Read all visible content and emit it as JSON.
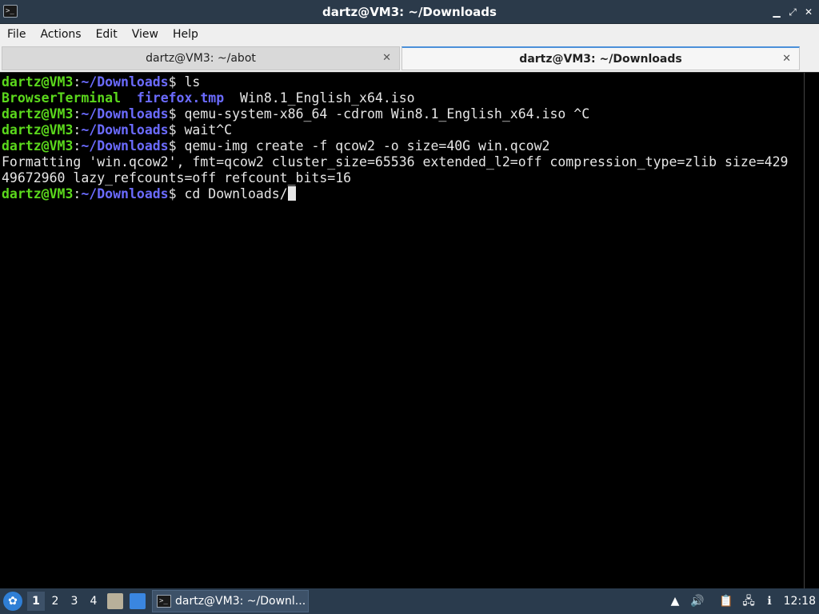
{
  "window": {
    "title": "dartz@VM3: ~/Downloads",
    "app_icon": ">_",
    "minimize_symbol": "▁",
    "maximize_symbol": "⤢",
    "close_symbol": "✕"
  },
  "menu": {
    "items": [
      "File",
      "Actions",
      "Edit",
      "View",
      "Help"
    ]
  },
  "tabs": [
    {
      "label": "dartz@VM3: ~/abot",
      "active": false,
      "close": "✕"
    },
    {
      "label": "dartz@VM3: ~/Downloads",
      "active": true,
      "close": "✕"
    }
  ],
  "terminal": {
    "prompt_user": "dartz@VM3",
    "prompt_sep": ":",
    "prompt_path": "~/Downloads",
    "prompt_end": "$",
    "lines": [
      {
        "type": "cmd",
        "text": " ls"
      },
      {
        "type": "ls",
        "items": [
          {
            "text": "BrowserTerminal",
            "style": "green"
          },
          {
            "text": "  ",
            "style": "plain"
          },
          {
            "text": "firefox.tmp",
            "style": "blue"
          },
          {
            "text": "  Win8.1_English_x64.iso",
            "style": "plain"
          }
        ]
      },
      {
        "type": "cmd",
        "text": " qemu-system-x86_64 -cdrom Win8.1_English_x64.iso ^C"
      },
      {
        "type": "cmd",
        "text": " wait^C"
      },
      {
        "type": "cmd",
        "text": " qemu-img create -f qcow2 -o size=40G win.qcow2"
      },
      {
        "type": "out",
        "text": "Formatting 'win.qcow2', fmt=qcow2 cluster_size=65536 extended_l2=off compression_type=zlib size=429"
      },
      {
        "type": "out",
        "text": "49672960 lazy_refcounts=off refcount_bits=16"
      },
      {
        "type": "cmd",
        "text": " cd Downloads/",
        "cursor": true
      }
    ]
  },
  "taskbar": {
    "start_icon": "✿",
    "workspaces": [
      "1",
      "2",
      "3",
      "4"
    ],
    "active_workspace": "1",
    "launchers": [
      "file-manager-icon",
      "show-desktop-icon"
    ],
    "task_label": "dartz@VM3: ~/Downl...",
    "task_icon": ">_",
    "tray": {
      "notification_icon": "▲",
      "volume_icon": "🔊",
      "clipboard_icon": "📋",
      "network_icon": "🖧",
      "update_icon": "ℹ"
    },
    "clock": "12:18"
  }
}
